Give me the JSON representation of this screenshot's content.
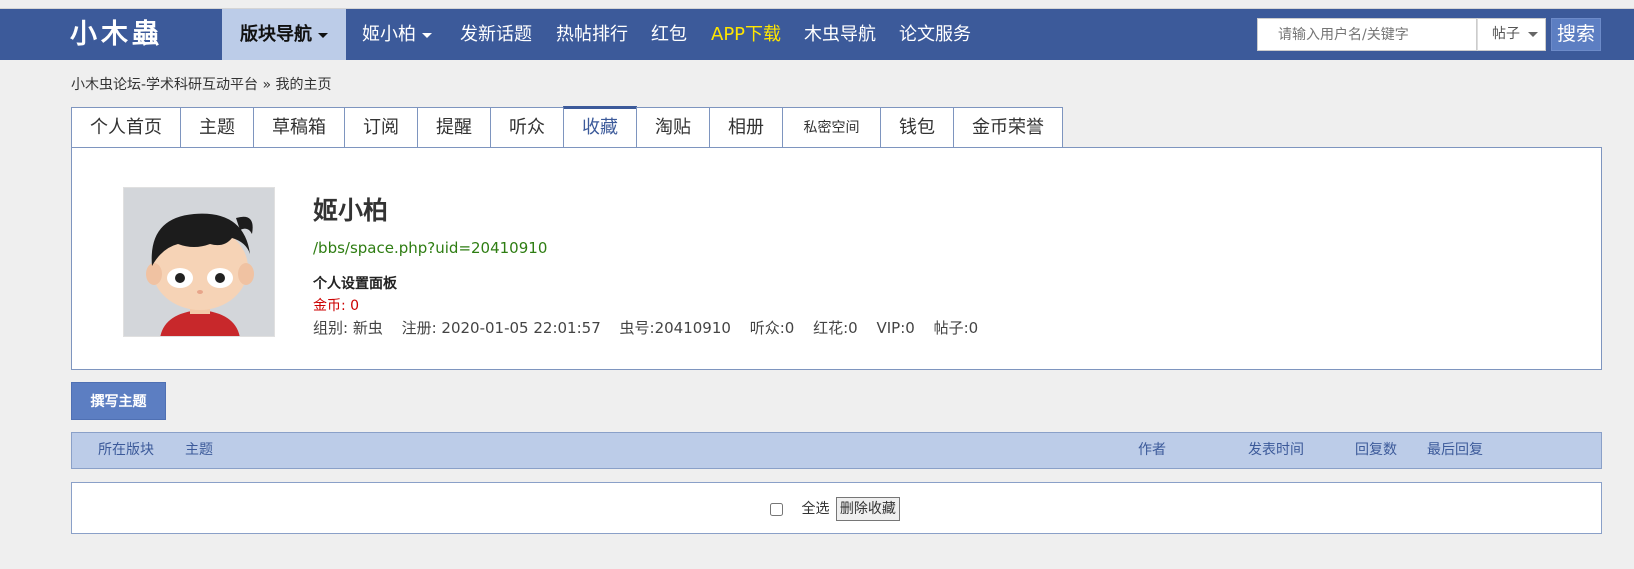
{
  "nav": {
    "logo": "小木蟲",
    "items": [
      {
        "label": "版块导航",
        "has_caret": true,
        "active": true
      },
      {
        "label": "姬小柏",
        "has_caret": true
      },
      {
        "label": "发新话题"
      },
      {
        "label": "热帖排行"
      },
      {
        "label": "红包"
      },
      {
        "label": "APP下载",
        "highlight": true
      },
      {
        "label": "木虫导航"
      },
      {
        "label": "论文服务"
      }
    ],
    "search_placeholder": "请输入用户名/关键字",
    "search_type": "帖子",
    "search_button": "搜索"
  },
  "breadcrumb": "小木虫论坛-学术科研互动平台 » 我的主页",
  "tabs": [
    {
      "label": "个人首页"
    },
    {
      "label": "主题"
    },
    {
      "label": "草稿箱"
    },
    {
      "label": "订阅"
    },
    {
      "label": "提醒"
    },
    {
      "label": "听众"
    },
    {
      "label": "收藏",
      "active": true
    },
    {
      "label": "淘贴"
    },
    {
      "label": "相册"
    },
    {
      "label": "私密空间"
    },
    {
      "label": "钱包"
    },
    {
      "label": "金币荣誉"
    }
  ],
  "profile": {
    "name": "姬小柏",
    "url": "/bbs/space.php?uid=20410910",
    "settings_label": "个人设置面板",
    "coins": "金币: 0",
    "stats": {
      "group": "组别: 新虫",
      "registered": "注册: 2020-01-05 22:01:57",
      "uid": "虫号:20410910",
      "listeners": "听众:0",
      "flowers": "红花:0",
      "vip": "VIP:0",
      "posts": "帖子:0"
    }
  },
  "write_button": "撰写主题",
  "table": {
    "headers": {
      "board": "所在版块",
      "topic": "主题",
      "author": "作者",
      "post_time": "发表时间",
      "replies": "回复数",
      "last_reply": "最后回复"
    },
    "select_all": "全选",
    "delete_button": "删除收藏"
  }
}
